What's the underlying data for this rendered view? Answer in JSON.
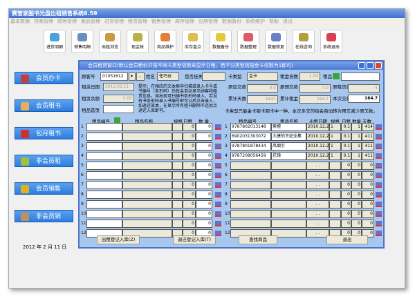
{
  "app": {
    "title": "赛管家图书光盘出租销售系统8.59",
    "menu": [
      "基本数据",
      "供商管理",
      "顾客管理",
      "商品管理",
      "进货管理",
      "租赁管理",
      "销售管理",
      "库存管理",
      "出纳管理",
      "数据备份",
      "系统维护",
      "帮助",
      "退出"
    ],
    "toolbar": [
      "进货明细",
      "销售明细",
      "出租浏览",
      "现金帐",
      "商品维护",
      "库存盘点",
      "数据备份",
      "数据整理",
      "数据修复",
      "在线咨询",
      "系统退出"
    ],
    "sidebar": [
      "会员办卡",
      "会员租书",
      "包月租书",
      "非会员租",
      "会员销售",
      "非会员销"
    ],
    "date": "2012 年  2 月 11 日"
  },
  "dialog": {
    "title": "会员租赁窗口(默认会员租价并按不同卡类型倍数来显示日租。若不分类型则按金卡倍数为1即可)",
    "labels": {
      "customer_no": "顾客号",
      "name": "姓名",
      "is_member": "是否挂失",
      "rent_date": "租赁日期",
      "balance": "租赁余额",
      "rent_first": "租品首页",
      "card_type": "卡类型",
      "rent_mult": "租金倍数",
      "goods": "租品",
      "orig_due": "原应交款",
      "orig_prepaid": "原预交款",
      "orig_qty": "原租货量",
      "total_days": "累计天数",
      "total_rent": "累计租金",
      "this_pay": "本次交款"
    },
    "values": {
      "customer_no": "01051612",
      "name": "任巧云",
      "rent_date": "2012.02.11",
      "balance": "3.00",
      "card_type": "金卡",
      "rent_mult": "1.00",
      "orig_due": "0.0",
      "orig_prepaid": "7.0",
      "orig_qty": "4",
      "total_days": "1647",
      "total_rent": "164.7",
      "this_pay": "164.7"
    },
    "tip": "提示：在相应的文本框中扫描或录入卡号或书编号（条形码）后就会自动显示顾客和租赁信息。如出现可扫描书条形码录入，若没有书条形码录入书编号即可以后点击录入，如退还某本，在显示所有租书删除不还后点退还入库即可。",
    "note": "卡类型只能金卡银卡铜卡中一种，本次多交的钱会自动转为预交减少原欠款。",
    "left_headers": [
      "租品编号",
      "租品名称",
      "规格",
      "日租",
      "数 量"
    ],
    "right_headers": [
      "租品编号",
      "租品名称",
      "出租日期",
      "规格",
      "日租",
      "数量",
      "天数"
    ],
    "right_rows": [
      [
        "9787802013148",
        "紫檀",
        "2010.12.25",
        "1",
        "0.1",
        "1",
        "414"
      ],
      [
        "6902031303072",
        "大唐的王妃全集",
        "2010.12.28",
        "1",
        "0.1",
        "1",
        "411"
      ],
      [
        "9787801878434",
        "风烟引",
        "2010.12.28",
        "1",
        "0.1",
        "1",
        "411"
      ],
      [
        "9787208056459",
        "花镜",
        "2010.12.28",
        "1",
        "0.1",
        "1",
        "411"
      ]
    ],
    "buttons": [
      "出租登记入库(Z)",
      "退还登记入库(T)",
      "查找商品",
      "退出"
    ]
  }
}
